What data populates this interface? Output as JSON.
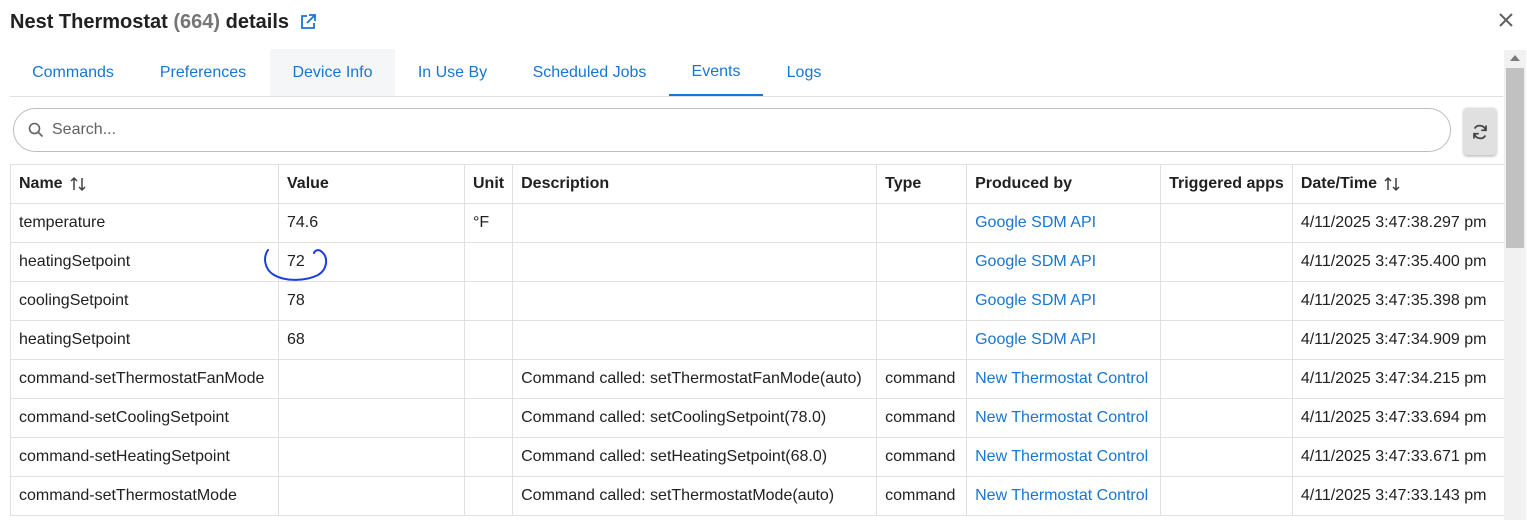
{
  "header": {
    "title_prefix": "Nest Thermostat",
    "count": "(664)",
    "title_suffix": "details",
    "external_link_icon": "external-link-icon",
    "close_icon": "close-icon"
  },
  "tabs": [
    {
      "label": "Commands",
      "active": false
    },
    {
      "label": "Preferences",
      "active": false
    },
    {
      "label": "Device Info",
      "active": false,
      "hovered": true
    },
    {
      "label": "In Use By",
      "active": false
    },
    {
      "label": "Scheduled Jobs",
      "active": false
    },
    {
      "label": "Events",
      "active": true
    },
    {
      "label": "Logs",
      "active": false
    }
  ],
  "search": {
    "placeholder": "Search...",
    "value": "",
    "icon": "search-icon"
  },
  "refresh": {
    "icon": "refresh-icon"
  },
  "table": {
    "columns": [
      "Name",
      "Value",
      "Unit",
      "Description",
      "Type",
      "Produced by",
      "Triggered apps",
      "Date/Time"
    ],
    "sortable_columns": [
      "Name",
      "Date/Time"
    ],
    "rows": [
      {
        "name": "temperature",
        "value": "74.6",
        "unit": "°F",
        "description": "",
        "type": "",
        "produced_by": "Google SDM API",
        "triggered_apps": "",
        "datetime": "4/11/2025 3:47:38.297 pm"
      },
      {
        "name": "heatingSetpoint",
        "value": "72",
        "unit": "",
        "description": "",
        "type": "",
        "produced_by": "Google SDM API",
        "triggered_apps": "",
        "datetime": "4/11/2025 3:47:35.400 pm"
      },
      {
        "name": "coolingSetpoint",
        "value": "78",
        "unit": "",
        "description": "",
        "type": "",
        "produced_by": "Google SDM API",
        "triggered_apps": "",
        "datetime": "4/11/2025 3:47:35.398 pm"
      },
      {
        "name": "heatingSetpoint",
        "value": "68",
        "unit": "",
        "description": "",
        "type": "",
        "produced_by": "Google SDM API",
        "triggered_apps": "",
        "datetime": "4/11/2025 3:47:34.909 pm"
      },
      {
        "name": "command-setThermostatFanMode",
        "value": "",
        "unit": "",
        "description": "Command called: setThermostatFanMode(auto)",
        "type": "command",
        "produced_by": "New Thermostat Control",
        "triggered_apps": "",
        "datetime": "4/11/2025 3:47:34.215 pm"
      },
      {
        "name": "command-setCoolingSetpoint",
        "value": "",
        "unit": "",
        "description": "Command called: setCoolingSetpoint(78.0)",
        "type": "command",
        "produced_by": "New Thermostat Control",
        "triggered_apps": "",
        "datetime": "4/11/2025 3:47:33.694 pm"
      },
      {
        "name": "command-setHeatingSetpoint",
        "value": "",
        "unit": "",
        "description": "Command called: setHeatingSetpoint(68.0)",
        "type": "command",
        "produced_by": "New Thermostat Control",
        "triggered_apps": "",
        "datetime": "4/11/2025 3:47:33.671 pm"
      },
      {
        "name": "command-setThermostatMode",
        "value": "",
        "unit": "",
        "description": "Command called: setThermostatMode(auto)",
        "type": "command",
        "produced_by": "New Thermostat Control",
        "triggered_apps": "",
        "datetime": "4/11/2025 3:47:33.143 pm"
      }
    ]
  },
  "annotation": {
    "type": "hand-drawn circle",
    "color": "#1a3fe0"
  },
  "colors": {
    "accent": "#1976d2",
    "border": "#e0e0e0",
    "muted": "#757575"
  }
}
